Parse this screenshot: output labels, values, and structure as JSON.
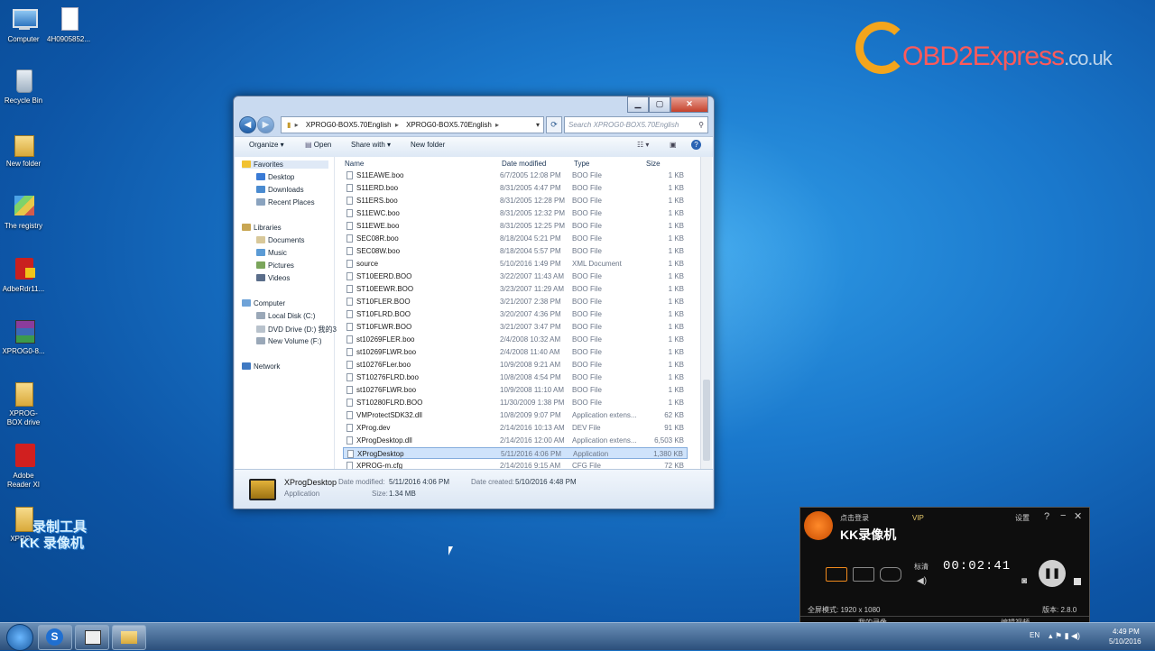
{
  "desktop": {
    "icons": [
      {
        "label": "Computer"
      },
      {
        "label": "4H0905852..."
      },
      {
        "label": "Recycle Bin"
      },
      {
        "label": "New folder"
      },
      {
        "label": "The registry"
      },
      {
        "label": "AdbeRdr11..."
      },
      {
        "label": "XPROG0-8..."
      },
      {
        "label": "XPROG-BOX drive"
      },
      {
        "label": "Adobe Reader XI"
      },
      {
        "label": "XPRO..."
      }
    ],
    "logo": {
      "main": "OBD2Express",
      "suffix": ".co.uk"
    },
    "watermark": {
      "line1": "录制工具",
      "line2": "KK 录像机"
    }
  },
  "explorer": {
    "address": {
      "seg1": "XPROG0-BOX5.70English",
      "seg2": "XPROG0-BOX5.70English"
    },
    "search_placeholder": "Search XPROG0-BOX5.70English",
    "toolbar": {
      "organize": "Organize ▾",
      "open": "Open",
      "share": "Share with ▾",
      "new_folder": "New folder"
    },
    "sidebar": {
      "favorites": "Favorites",
      "desktop": "Desktop",
      "downloads": "Downloads",
      "recent": "Recent Places",
      "libraries": "Libraries",
      "documents": "Documents",
      "music": "Music",
      "pictures": "Pictures",
      "videos": "Videos",
      "computer": "Computer",
      "local_disk": "Local Disk (C:)",
      "dvd": "DVD Drive (D:) 我的3",
      "new_volume": "New Volume (F:)",
      "network": "Network"
    },
    "columns": {
      "name": "Name",
      "date": "Date modified",
      "type": "Type",
      "size": "Size"
    },
    "files": [
      {
        "name": "S11EAWE.boo",
        "date": "6/7/2005 12:08 PM",
        "type": "BOO File",
        "size": "1 KB"
      },
      {
        "name": "S11ERD.boo",
        "date": "8/31/2005 4:47 PM",
        "type": "BOO File",
        "size": "1 KB"
      },
      {
        "name": "S11ERS.boo",
        "date": "8/31/2005 12:28 PM",
        "type": "BOO File",
        "size": "1 KB"
      },
      {
        "name": "S11EWC.boo",
        "date": "8/31/2005 12:32 PM",
        "type": "BOO File",
        "size": "1 KB"
      },
      {
        "name": "S11EWE.boo",
        "date": "8/31/2005 12:25 PM",
        "type": "BOO File",
        "size": "1 KB"
      },
      {
        "name": "SEC08R.boo",
        "date": "8/18/2004 5:21 PM",
        "type": "BOO File",
        "size": "1 KB"
      },
      {
        "name": "SEC08W.boo",
        "date": "8/18/2004 5:57 PM",
        "type": "BOO File",
        "size": "1 KB"
      },
      {
        "name": "source",
        "date": "5/10/2016 1:49 PM",
        "type": "XML Document",
        "size": "1 KB"
      },
      {
        "name": "ST10EERD.BOO",
        "date": "3/22/2007 11:43 AM",
        "type": "BOO File",
        "size": "1 KB"
      },
      {
        "name": "ST10EEWR.BOO",
        "date": "3/23/2007 11:29 AM",
        "type": "BOO File",
        "size": "1 KB"
      },
      {
        "name": "ST10FLER.BOO",
        "date": "3/21/2007 2:38 PM",
        "type": "BOO File",
        "size": "1 KB"
      },
      {
        "name": "ST10FLRD.BOO",
        "date": "3/20/2007 4:36 PM",
        "type": "BOO File",
        "size": "1 KB"
      },
      {
        "name": "ST10FLWR.BOO",
        "date": "3/21/2007 3:47 PM",
        "type": "BOO File",
        "size": "1 KB"
      },
      {
        "name": "st10269FLER.boo",
        "date": "2/4/2008 10:32 AM",
        "type": "BOO File",
        "size": "1 KB"
      },
      {
        "name": "st10269FLWR.boo",
        "date": "2/4/2008 11:40 AM",
        "type": "BOO File",
        "size": "1 KB"
      },
      {
        "name": "st10276FLer.boo",
        "date": "10/9/2008 9:21 AM",
        "type": "BOO File",
        "size": "1 KB"
      },
      {
        "name": "ST10276FLRD.boo",
        "date": "10/8/2008 4:54 PM",
        "type": "BOO File",
        "size": "1 KB"
      },
      {
        "name": "st10276FLWR.boo",
        "date": "10/9/2008 11:10 AM",
        "type": "BOO File",
        "size": "1 KB"
      },
      {
        "name": "ST10280FLRD.BOO",
        "date": "11/30/2009 1:38 PM",
        "type": "BOO File",
        "size": "1 KB"
      },
      {
        "name": "VMProtectSDK32.dll",
        "date": "10/8/2009 9:07 PM",
        "type": "Application extens...",
        "size": "62 KB"
      },
      {
        "name": "XProg.dev",
        "date": "2/14/2016 10:13 AM",
        "type": "DEV File",
        "size": "91 KB"
      },
      {
        "name": "XProgDesktop.dll",
        "date": "2/14/2016 12:00 AM",
        "type": "Application extens...",
        "size": "6,503 KB"
      },
      {
        "name": "XProgDesktop",
        "date": "5/11/2016 4:06 PM",
        "type": "Application",
        "size": "1,380 KB"
      },
      {
        "name": "XPROG-m.cfg",
        "date": "2/14/2016 9:15 AM",
        "type": "CFG File",
        "size": "72 KB"
      }
    ],
    "selected_index": 22,
    "details": {
      "name": "XProgDesktop",
      "kind": "Application",
      "modified_label": "Date modified:",
      "modified": "5/11/2016 4:06 PM",
      "created_label": "Date created:",
      "created": "5/10/2016 4:48 PM",
      "size_label": "Size:",
      "size": "1.34 MB"
    }
  },
  "recorder": {
    "login": "点击登录",
    "vip": "VIP",
    "settings": "设置",
    "help": "?",
    "title": "KK录像机",
    "quality": "标清",
    "timer": "00:02:41",
    "fullscreen": "全屏模式: 1920 x 1080",
    "version": "版本: 2.8.0",
    "tab1": "我的录像",
    "tab2": "编辑视频"
  },
  "taskbar": {
    "lang": "EN",
    "time": "4:49 PM",
    "date": "5/10/2016"
  }
}
